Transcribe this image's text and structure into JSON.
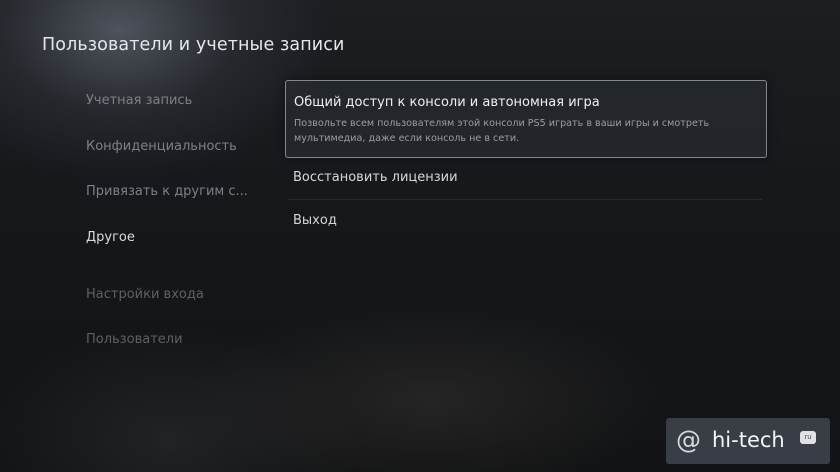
{
  "page": {
    "title": "Пользователи и учетные записи"
  },
  "sidebar": {
    "items": [
      {
        "label": "Учетная запись"
      },
      {
        "label": "Конфиденциальность"
      },
      {
        "label": "Привязать к другим с..."
      },
      {
        "label": "Другое",
        "active": true
      },
      {
        "label": "Настройки входа"
      },
      {
        "label": "Пользователи"
      }
    ]
  },
  "main": {
    "options": [
      {
        "title": "Общий доступ к консоли и автономная игра",
        "description": "Позвольте всем пользователям этой консоли PS5 играть в ваши игры и смотреть мультимедиа, даже если консоль не в сети.",
        "focused": true
      },
      {
        "title": "Восстановить лицензии"
      },
      {
        "title": "Выход"
      }
    ]
  },
  "watermark": {
    "at_symbol": "@",
    "text": "hi-tech",
    "badge": "ru"
  },
  "colors": {
    "background": "#17191c",
    "text_primary": "#e6e7ea",
    "text_muted": "#7d8086",
    "focus_border": "#d2d6de"
  }
}
